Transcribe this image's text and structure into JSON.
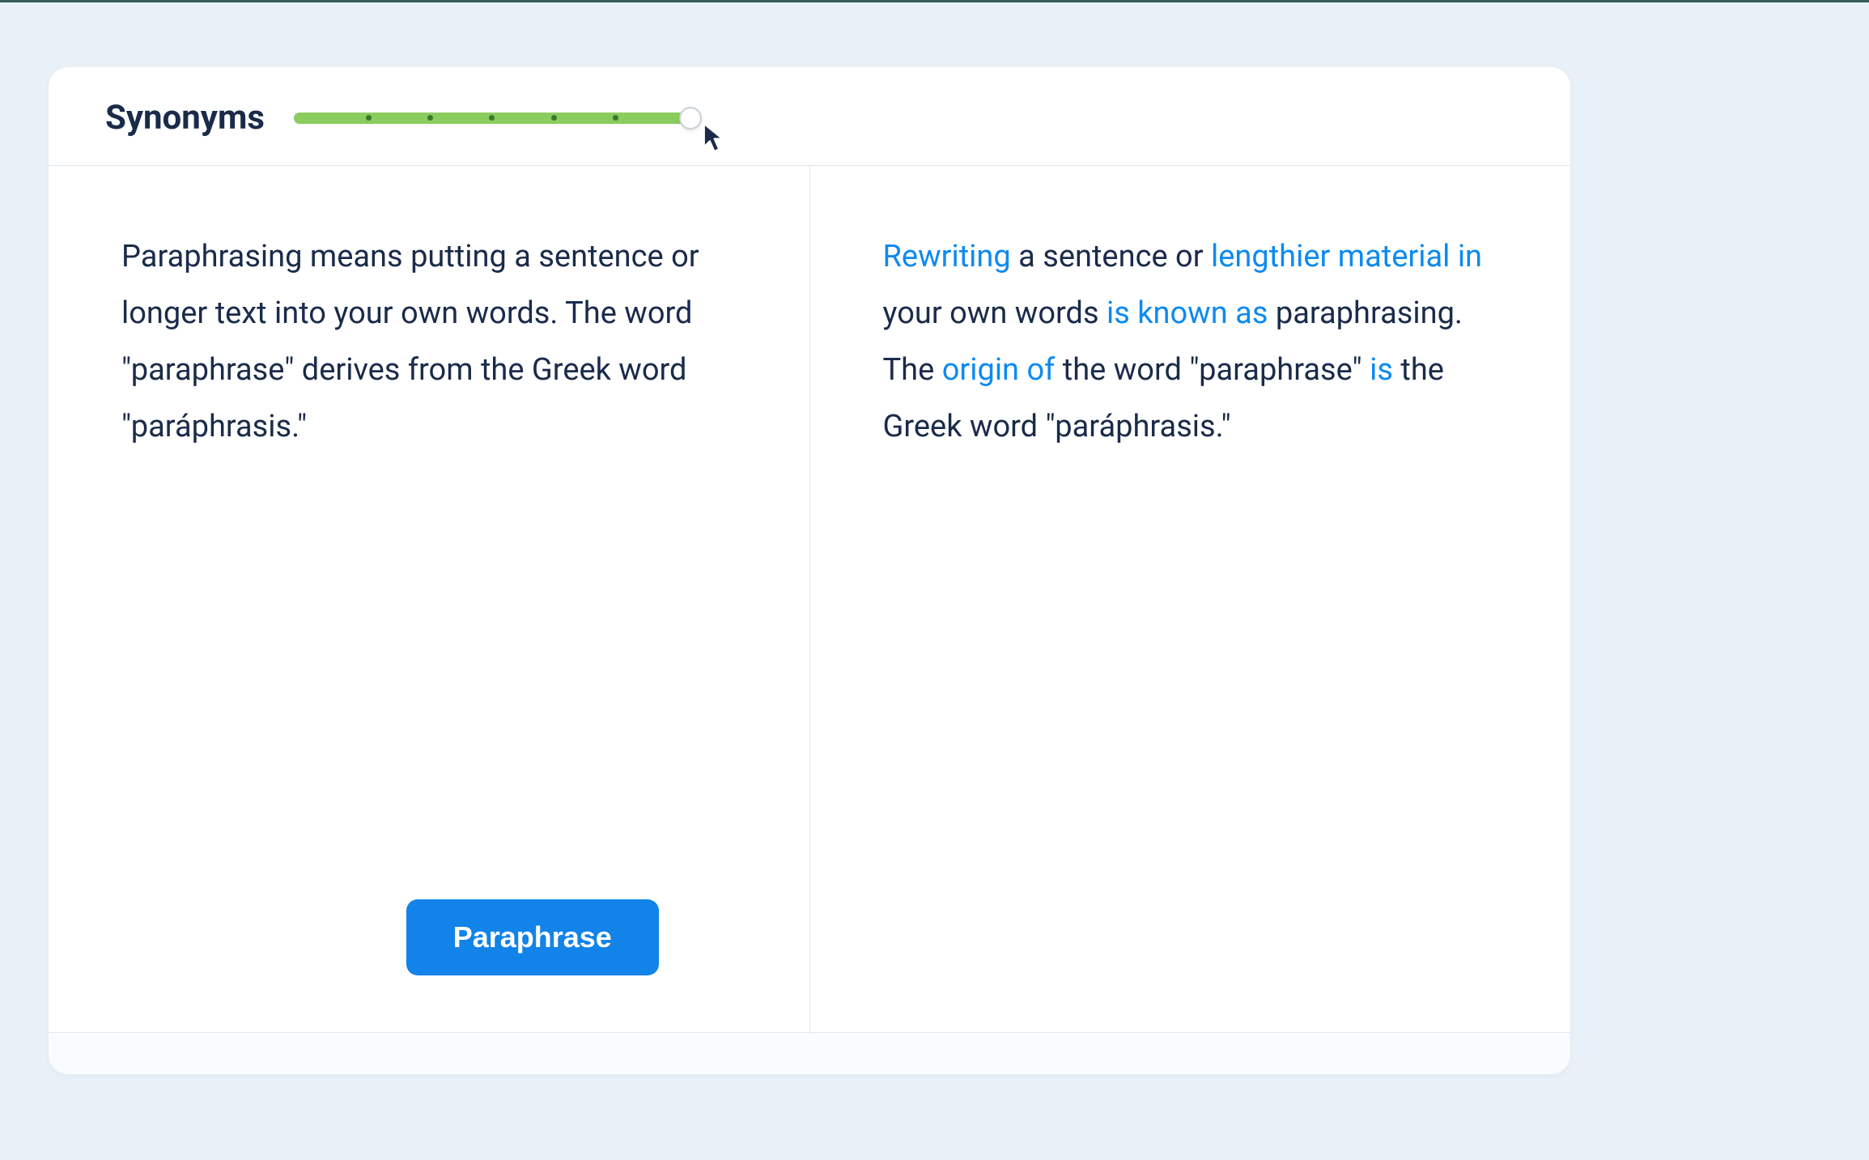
{
  "header": {
    "title": "Synonyms",
    "slider": {
      "position": 100,
      "stops": 5
    }
  },
  "input": {
    "text": "Paraphrasing means putting a sentence or longer text into your own words. The word \"paraphrase\" derives from the Greek word \"paráphrasis.\""
  },
  "output": {
    "segments": [
      {
        "text": "Rewriting",
        "changed": true
      },
      {
        "text": " a sentence or ",
        "changed": false
      },
      {
        "text": "lengthier material in",
        "changed": true
      },
      {
        "text": " your own words ",
        "changed": false
      },
      {
        "text": "is known as",
        "changed": true
      },
      {
        "text": " paraphrasing. The ",
        "changed": false
      },
      {
        "text": "origin of",
        "changed": true
      },
      {
        "text": " the word \"paraphrase\" ",
        "changed": false
      },
      {
        "text": "is",
        "changed": true
      },
      {
        "text": " the Greek word \"paráphrasis.\"",
        "changed": false
      }
    ]
  },
  "actions": {
    "paraphrase_label": "Paraphrase"
  },
  "colors": {
    "accent": "#1283e8",
    "highlight": "#0d8af0",
    "slider_fill": "#8acc5e",
    "text": "#1a2b4a"
  }
}
